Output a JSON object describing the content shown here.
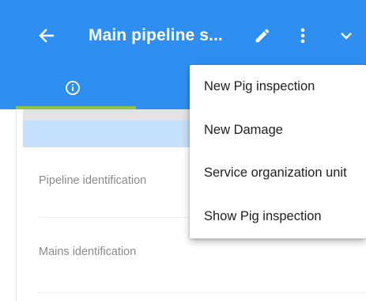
{
  "header": {
    "title": "Main pipeline s...",
    "back_icon": "arrow-back-icon",
    "edit_icon": "pencil-icon",
    "more_icon": "more-vert-icon",
    "expand_icon": "chevron-down-icon"
  },
  "tabs": {
    "active_icon": "info-icon"
  },
  "form": {
    "fields": [
      {
        "label": "Pipeline identification"
      },
      {
        "label": "Mains identification"
      }
    ]
  },
  "menu": {
    "items": [
      {
        "label": "New Pig inspection"
      },
      {
        "label": "New Damage"
      },
      {
        "label": "Service organization unit"
      },
      {
        "label": "Show Pig inspection"
      }
    ]
  },
  "colors": {
    "appbar": "#2f8ff0",
    "tab_indicator": "#8bc34a",
    "highlight_band": "#c4e0fa"
  }
}
